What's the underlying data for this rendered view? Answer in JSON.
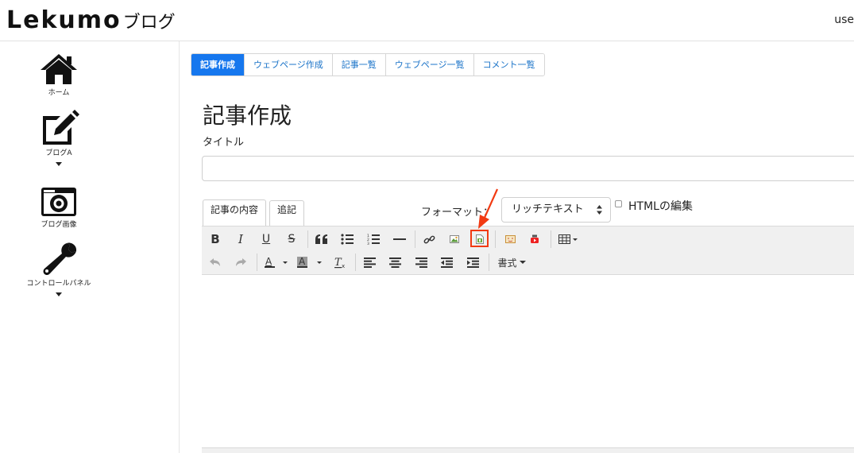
{
  "header": {
    "logo_main": "Lekumo",
    "logo_sub": "ブログ",
    "user": "use"
  },
  "sidebar": {
    "items": [
      {
        "label": "ホーム",
        "icon": "home-icon"
      },
      {
        "label": "ブログA",
        "icon": "edit-icon"
      },
      {
        "label": "ブログ画像",
        "icon": "camera-icon"
      },
      {
        "label": "コントロールパネル",
        "icon": "wrench-icon"
      }
    ]
  },
  "tabs": [
    "記事作成",
    "ウェブページ作成",
    "記事一覧",
    "ウェブページ一覧",
    "コメント一覧"
  ],
  "page": {
    "title": "記事作成",
    "title_label": "タイトル",
    "title_value": ""
  },
  "editor": {
    "tabs": [
      "記事の内容",
      "追記"
    ],
    "format_label": "フォーマット：",
    "format_value": "リッチテキスト",
    "html_edit_label": "HTMLの編集",
    "style_menu_label": "書式"
  },
  "colors": {
    "accent": "#1677ee",
    "highlight": "#f23a12"
  }
}
